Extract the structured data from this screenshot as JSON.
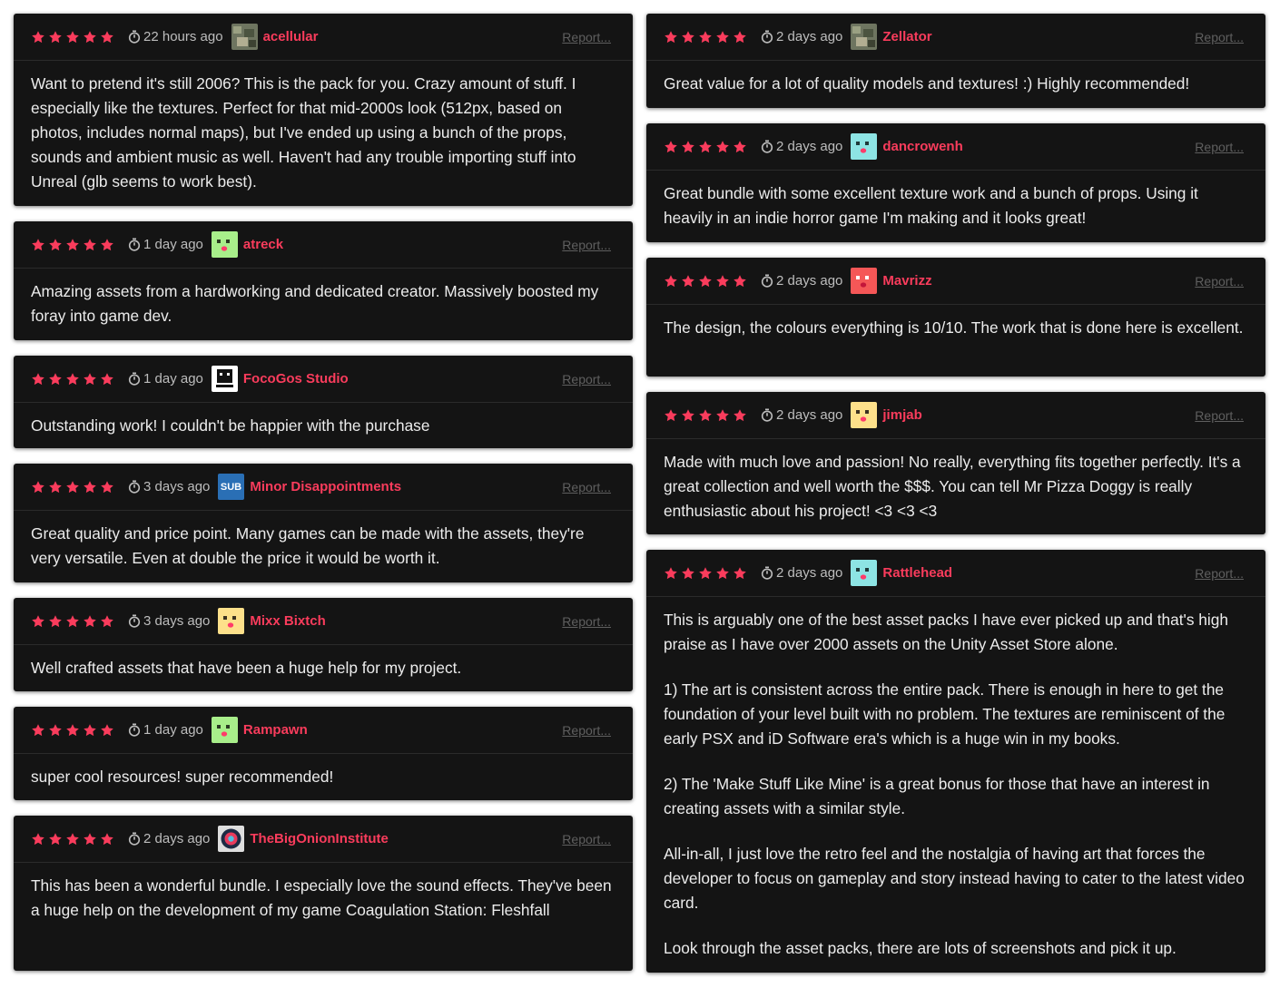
{
  "colors": {
    "card_background": "#141414",
    "star": "#fa3c5c",
    "username": "#fa3c5c",
    "body_text": "#ececec",
    "timestamp": "#bdbdbd",
    "report_link": "#5f5f5f"
  },
  "report_label": "Report...",
  "reviews": [
    {
      "stars": 5,
      "time": "22 hours ago",
      "user": "acellular",
      "avatar": "photo-avatar",
      "text": [
        "Want to pretend it's still 2006? This is the pack for you. Crazy amount of stuff. I especially like the textures. Perfect for that mid-2000s look (512px, based on photos, includes normal maps), but I've ended up using a bunch of the props, sounds and ambient music as well. Haven't had any trouble importing stuff into Unreal (glb seems to work best)."
      ]
    },
    {
      "stars": 5,
      "time": "1 day ago",
      "user": "atreck",
      "avatar": "green-face-avatar",
      "text": [
        "Amazing assets from a hardworking and dedicated creator. Massively boosted my foray into game dev."
      ]
    },
    {
      "stars": 5,
      "time": "1 day ago",
      "user": "FocoGos Studio",
      "avatar": "studio-logo-avatar",
      "text": [
        "Outstanding work! I couldn't be happier with the purchase"
      ]
    },
    {
      "stars": 5,
      "time": "3 days ago",
      "user": "Minor Disappointments",
      "avatar": "sub-logo-avatar",
      "avatar_text": "SUB",
      "text": [
        "Great quality and price point. Many games can be made with the assets, they're very versatile. Even at double the price it would be worth it."
      ]
    },
    {
      "stars": 5,
      "time": "3 days ago",
      "user": "Mixx Bixtch",
      "avatar": "yellow-face-avatar",
      "text": [
        "Well crafted assets that have been a huge help for my project."
      ]
    },
    {
      "stars": 5,
      "time": "1 day ago",
      "user": "Rampawn",
      "avatar": "green-face-avatar",
      "text": [
        "super cool resources! super recommended!"
      ]
    },
    {
      "stars": 5,
      "time": "2 days ago",
      "user": "TheBigOnionInstitute",
      "avatar": "onion-logo-avatar",
      "text": [
        "This has been a wonderful bundle. I especially love the sound effects. They've been a huge help on the development of my game Coagulation Station: Fleshfall"
      ]
    },
    {
      "stars": 5,
      "time": "2 days ago",
      "user": "Zellator",
      "avatar": "photo-avatar",
      "text": [
        "Great value for a lot of quality models and textures! :) Highly recommended!"
      ]
    },
    {
      "stars": 5,
      "time": "2 days ago",
      "user": "dancrowenh",
      "avatar": "cyan-face-avatar",
      "text": [
        "Great bundle with some excellent texture work and a bunch of props. Using it heavily in an indie horror game I'm making and it looks great!"
      ]
    },
    {
      "stars": 5,
      "time": "2 days ago",
      "user": "Mavrizz",
      "avatar": "red-face-avatar",
      "text": [
        "The design, the colours everything is 10/10. The work that is done here is excellent."
      ]
    },
    {
      "stars": 5,
      "time": "2 days ago",
      "user": "jimjab",
      "avatar": "yellow-face-avatar",
      "text": [
        "Made with much love and passion! No really, everything fits together perfectly. It's a great collection and well worth the $$$. You can tell Mr Pizza Doggy is really enthusiastic about his project! <3 <3 <3"
      ]
    },
    {
      "stars": 5,
      "time": "2 days ago",
      "user": "Rattlehead",
      "avatar": "cyan-face-avatar",
      "text": [
        "This is arguably one of the best asset packs I have ever picked up and that's high praise as I have over 2000 assets on the Unity Asset Store alone.",
        "1) The art is consistent across the entire pack. There is enough in here to get the foundation of your level built with no problem. The textures are reminiscent of the early PSX and iD Software era's which is a huge win in my books.",
        "2) The 'Make Stuff Like Mine' is a great bonus for those that have an interest in creating assets with a similar style.",
        "All-in-all, I just love the retro feel and the nostalgia of having art that forces the developer to focus on gameplay and story instead having to cater to the latest video card.",
        "Look through the asset packs, there are lots of screenshots and pick it up."
      ]
    }
  ]
}
